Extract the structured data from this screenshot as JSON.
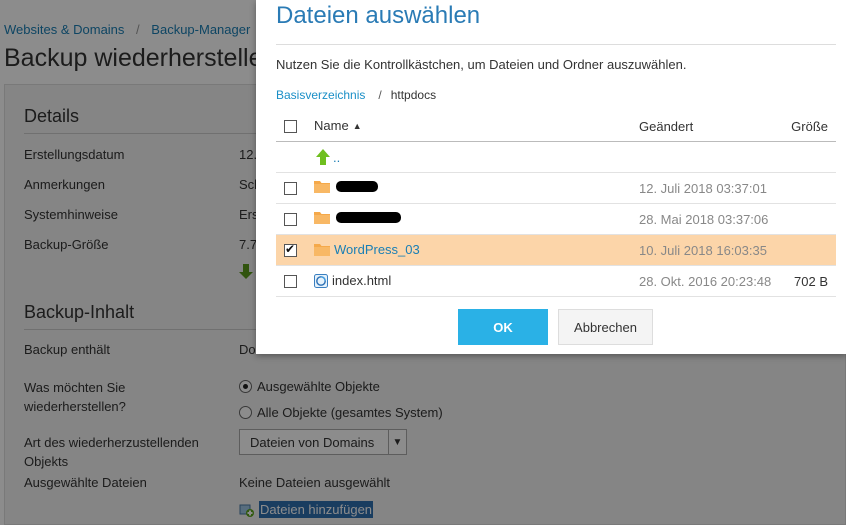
{
  "breadcrumb": {
    "items": [
      "Websites & Domains",
      "Backup-Manager"
    ]
  },
  "page": {
    "title": "Backup wiederherstellen"
  },
  "details": {
    "title": "Details",
    "rows": [
      {
        "label": "Erstellungsdatum",
        "value": "12."
      },
      {
        "label": "Anmerkungen",
        "value": "Sch"
      },
      {
        "label": "Systemhinweise",
        "value": "Ers"
      },
      {
        "label": "Backup-Größe",
        "value": "7.7"
      }
    ]
  },
  "content": {
    "title": "Backup-Inhalt",
    "contains_label": "Backup enthält",
    "contains_value": "Do",
    "restore_label": "Was möchten Sie wiederherstellen?",
    "option_selected": "Ausgewählte Objekte",
    "option_all": "Alle Objekte (gesamtes System)",
    "type_label": "Art des wiederherzustellenden Objekts",
    "type_value": "Dateien von Domains",
    "files_label": "Ausgewählte Dateien",
    "files_value": "Keine Dateien ausgewählt",
    "add_files": "Dateien hinzufügen"
  },
  "dialog": {
    "title": "Dateien auswählen",
    "description": "Nutzen Sie die Kontrollkästchen, um Dateien und Ordner auszuwählen.",
    "path_root": "Basisverzeichnis",
    "path_sep": "/",
    "path_current": "httpdocs",
    "columns": {
      "name": "Name",
      "changed": "Geändert",
      "size": "Größe"
    },
    "up_label": "..",
    "files": [
      {
        "name": "",
        "changed": "12. Juli 2018 03:37:01",
        "size": "",
        "redacted": true
      },
      {
        "name": "",
        "changed": "28. Mai 2018 03:37:06",
        "size": "",
        "redacted": true
      },
      {
        "name": "WordPress_03",
        "changed": "10. Juli 2018 16:03:35",
        "size": "",
        "selected": true
      },
      {
        "name": "index.html",
        "changed": "28. Okt. 2016 20:23:48",
        "size": "702 B"
      }
    ],
    "ok": "OK",
    "cancel": "Abbrechen"
  },
  "colors": {
    "accent": "#2ab1e6",
    "link": "#1a7fb5",
    "selected_row": "#fcd5a9",
    "folder": "#f5a94a"
  }
}
